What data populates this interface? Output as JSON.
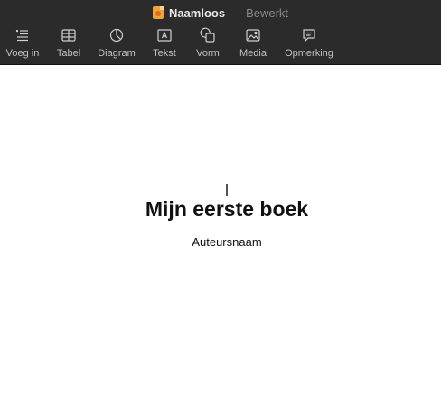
{
  "window": {
    "title": "Naamloos",
    "separator": "—",
    "state": "Bewerkt",
    "doc_icon": "pages-document-icon"
  },
  "toolbar": {
    "items": [
      {
        "label": "Voeg in",
        "icon": "insert-icon"
      },
      {
        "label": "Tabel",
        "icon": "table-icon"
      },
      {
        "label": "Diagram",
        "icon": "chart-icon"
      },
      {
        "label": "Tekst",
        "icon": "text-box-icon"
      },
      {
        "label": "Vorm",
        "icon": "shape-icon"
      },
      {
        "label": "Media",
        "icon": "media-icon"
      },
      {
        "label": "Opmerking",
        "icon": "comment-icon"
      }
    ]
  },
  "document": {
    "title": "Mijn eerste boek",
    "author": "Auteursnaam"
  },
  "colors": {
    "chrome_bg": "#2b2b2b",
    "toolbar_text": "#c2c2c2",
    "title_text": "#e8e8e8",
    "state_text": "#8a8a8a",
    "doc_icon": "#f0a33a"
  }
}
